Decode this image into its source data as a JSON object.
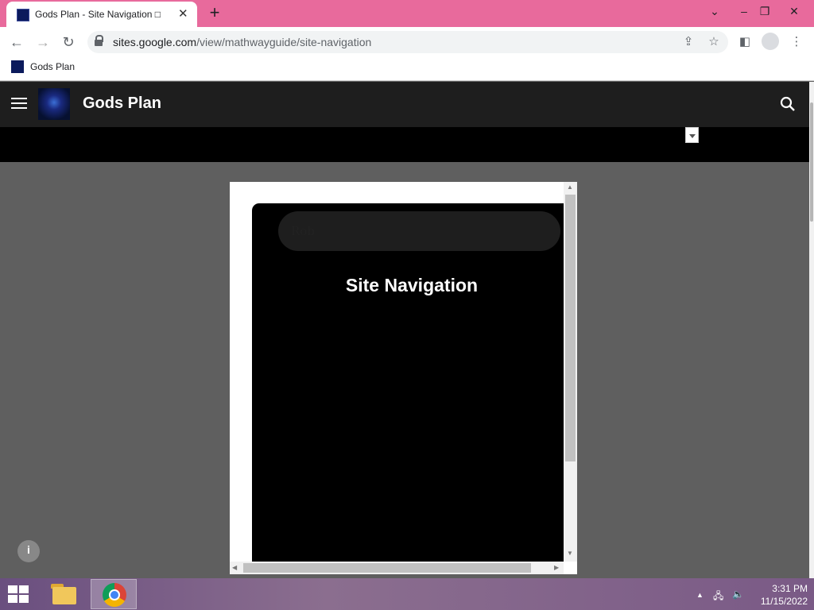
{
  "browser": {
    "tab_title": "Gods Plan - Site Navigation □",
    "url_host": "sites.google.com",
    "url_path": "/view/mathwayguide/site-navigation",
    "bookmark_label": "Gods Plan"
  },
  "site": {
    "title": "Gods Plan"
  },
  "embed": {
    "name_value": "Rob",
    "heading": "Site Navigation"
  },
  "taskbar": {
    "time": "3:31 PM",
    "date": "11/15/2022"
  },
  "colors": {
    "titlebar": "#e86a9c",
    "site_header": "#1e1e1e",
    "page_bg": "#5f5f5f"
  },
  "icons": [
    "tab-close-icon",
    "new-tab-icon",
    "back-icon",
    "forward-icon",
    "reload-icon",
    "lock-icon",
    "share-icon",
    "star-icon",
    "sidepanel-icon",
    "profile-icon",
    "menu-dots-icon",
    "hamburger-icon",
    "search-icon",
    "info-icon",
    "windows-start-icon",
    "file-explorer-icon",
    "chrome-icon",
    "network-icon",
    "volume-icon"
  ]
}
